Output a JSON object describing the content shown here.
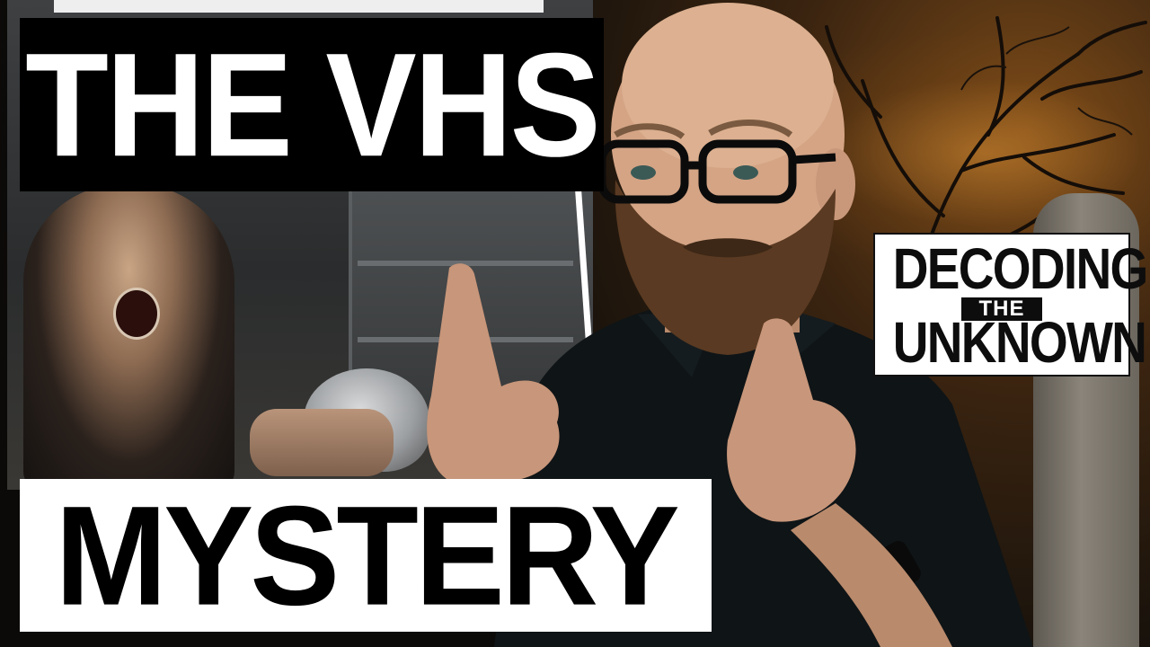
{
  "thumbnail": {
    "title_top": "THE VHS",
    "title_bottom": "MYSTERY"
  },
  "logo": {
    "line1": "DECODING",
    "line2": "THE",
    "line3": "UNKNOWN"
  },
  "colors": {
    "title_top_bg": "#000000",
    "title_top_fg": "#ffffff",
    "title_bottom_bg": "#ffffff",
    "title_bottom_fg": "#000000",
    "sky_orange": "#c8822e",
    "shirt": "#0f1416"
  }
}
